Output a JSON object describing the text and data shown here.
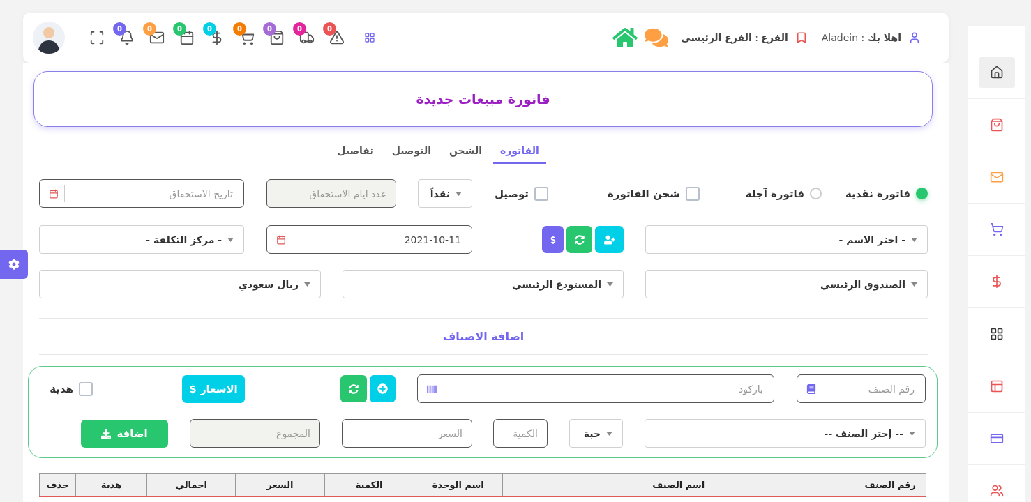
{
  "header": {
    "greeting": "**اهلا بك** : Aladein",
    "branch": "**الفرع** : **الفرع الرئيسي**",
    "notifications": [
      {
        "count": "0",
        "color": "#ea5455"
      },
      {
        "count": "0",
        "color": "#e3259c"
      },
      {
        "count": "0",
        "color": "#a66bd6"
      },
      {
        "count": "0",
        "color": "#f57c00"
      },
      {
        "count": "0",
        "color": "#00cfe8"
      },
      {
        "count": "0",
        "color": "#28c76f"
      },
      {
        "count": "0",
        "color": "#ff9f43"
      },
      {
        "count": "0",
        "color": "#7367f0"
      }
    ]
  },
  "page_title": "فاتورة مبيعات جديدة",
  "tabs": [
    {
      "label": "الفاتورة",
      "selected": true
    },
    {
      "label": "الشحن",
      "selected": false
    },
    {
      "label": "التوصيل",
      "selected": false
    },
    {
      "label": "تفاصيل",
      "selected": false
    }
  ],
  "invoice_type": [
    {
      "label": "فاتورة نقدية",
      "selected": true
    },
    {
      "label": "فاتورة آجلة",
      "selected": false
    }
  ],
  "options": [
    {
      "label": "شحن الفاتورة",
      "checked": false
    },
    {
      "label": "توصيل",
      "checked": false
    }
  ],
  "payment_select": "نقداً",
  "due_days": {
    "placeholder": "عدد ايام الاستحقاق",
    "disabled": true
  },
  "due_date": {
    "placeholder": "تاريخ الاستحقاق"
  },
  "customer_select": "- اختر الاسم -",
  "invoice_date": {
    "value": "2021-10-11"
  },
  "cost_center_select": "- مركز التكلفة -",
  "cashbox_select": "الصندوق الرئيسي",
  "warehouse_select": "المستودع الرئيسي",
  "currency_select": "ريال سعودي",
  "items_section": {
    "title": "اضافة الاصناف",
    "item_number": {
      "placeholder": "رقم الصنف"
    },
    "barcode": {
      "placeholder": "باركود"
    },
    "prices_button": "الاسعار $",
    "gift": {
      "label": "هدية",
      "checked": false
    },
    "item_select": "-- إختر الصنف --",
    "unit_select": "حبة",
    "quantity": {
      "placeholder": "الكمية"
    },
    "price": {
      "placeholder": "السعر"
    },
    "total": {
      "placeholder": "المجموع",
      "disabled": true
    },
    "add_button": "اضافة"
  },
  "table": {
    "columns": [
      "رقم الصنف",
      "اسم الصنف",
      "اسم الوحدة",
      "الكمية",
      "السعر",
      "اجمالي",
      "هدية",
      "حذف"
    ]
  },
  "sidebar": {
    "items": [
      {
        "selected": true
      },
      {
        "selected": false
      },
      {
        "selected": false
      },
      {
        "selected": false
      },
      {
        "selected": false
      },
      {
        "selected": false
      },
      {
        "selected": false
      },
      {
        "selected": false
      },
      {
        "selected": false
      }
    ]
  }
}
